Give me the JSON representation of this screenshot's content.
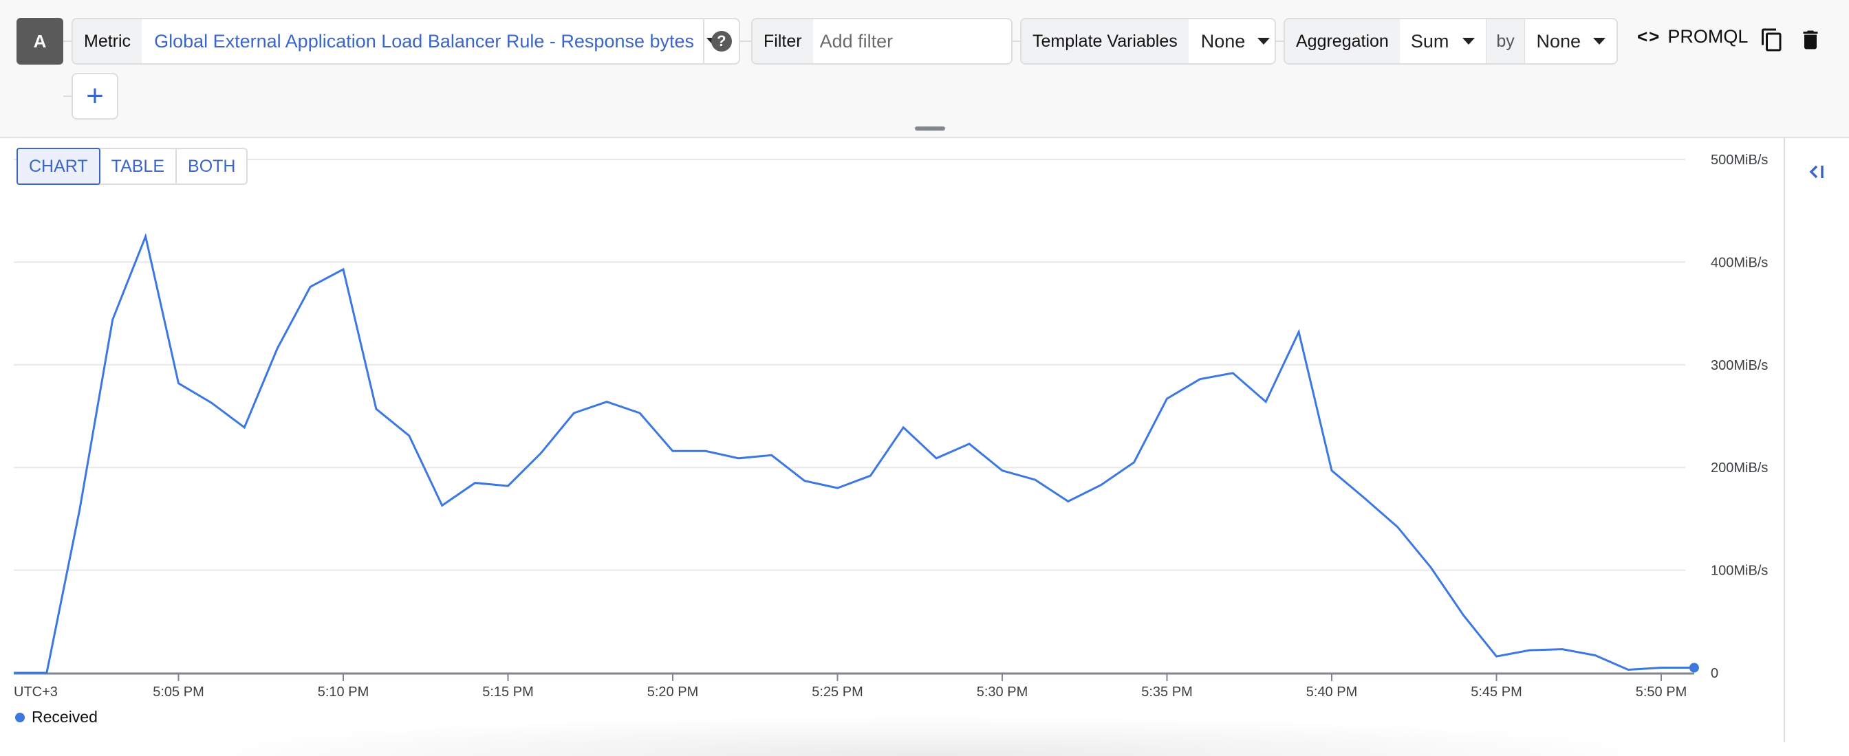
{
  "query": {
    "label": "A",
    "metric": {
      "label": "Metric",
      "value": "Global External Application Load Balancer Rule - Response bytes"
    },
    "help_icon": "help-circle-icon",
    "filter": {
      "label": "Filter",
      "placeholder": "Add filter",
      "value": ""
    },
    "template_variables": {
      "label": "Template Variables",
      "value": "None"
    },
    "aggregation": {
      "label": "Aggregation",
      "value": "Sum",
      "by_label": "by",
      "by_value": "None"
    },
    "promql_label": "PROMQL",
    "promql_icon": "<>",
    "add_button": "+"
  },
  "view_toggle": {
    "options": [
      "CHART",
      "TABLE",
      "BOTH"
    ],
    "selected": "CHART"
  },
  "side_panel": {
    "collapse_icon": "<|"
  },
  "colors": {
    "series": "#3c78e0",
    "accent": "#3b66c9"
  },
  "chart_data": {
    "type": "line",
    "title": "",
    "xlabel": "",
    "ylabel": "",
    "timezone_label": "UTC+3",
    "x": [
      "5:00 PM",
      "5:01 PM",
      "5:02 PM",
      "5:03 PM",
      "5:04 PM",
      "5:05 PM",
      "5:06 PM",
      "5:07 PM",
      "5:08 PM",
      "5:09 PM",
      "5:10 PM",
      "5:11 PM",
      "5:12 PM",
      "5:13 PM",
      "5:14 PM",
      "5:15 PM",
      "5:16 PM",
      "5:17 PM",
      "5:18 PM",
      "5:19 PM",
      "5:20 PM",
      "5:21 PM",
      "5:22 PM",
      "5:23 PM",
      "5:24 PM",
      "5:25 PM",
      "5:26 PM",
      "5:27 PM",
      "5:28 PM",
      "5:29 PM",
      "5:30 PM",
      "5:31 PM",
      "5:32 PM",
      "5:33 PM",
      "5:34 PM",
      "5:35 PM",
      "5:36 PM",
      "5:37 PM",
      "5:38 PM",
      "5:39 PM",
      "5:40 PM",
      "5:41 PM",
      "5:42 PM",
      "5:43 PM",
      "5:44 PM",
      "5:45 PM",
      "5:46 PM",
      "5:47 PM",
      "5:48 PM",
      "5:49 PM",
      "5:50 PM",
      "5:51 PM"
    ],
    "x_tick_labels": [
      "5:05 PM",
      "5:10 PM",
      "5:15 PM",
      "5:20 PM",
      "5:25 PM",
      "5:30 PM",
      "5:35 PM",
      "5:40 PM",
      "5:45 PM",
      "5:50 PM"
    ],
    "x_tick_minutes": [
      5,
      10,
      15,
      20,
      25,
      30,
      35,
      40,
      45,
      50
    ],
    "y_tick_labels": [
      "0",
      "100MiB/s",
      "200MiB/s",
      "300MiB/s",
      "400MiB/s",
      "500MiB/s"
    ],
    "y_ticks": [
      0,
      100,
      200,
      300,
      400,
      500
    ],
    "ylim": [
      0,
      500
    ],
    "y_unit": "MiB/s",
    "grid": true,
    "legend_position": "bottom-left",
    "series": [
      {
        "name": "Received",
        "color": "#3c78e0",
        "values": [
          0,
          0,
          159,
          344,
          425,
          282,
          263,
          239,
          316,
          376,
          393,
          257,
          231,
          163,
          185,
          182,
          214,
          253,
          264,
          253,
          216,
          216,
          209,
          212,
          187,
          180,
          192,
          239,
          209,
          223,
          197,
          188,
          167,
          183,
          205,
          267,
          286,
          292,
          264,
          332,
          197,
          170,
          142,
          103,
          56,
          16,
          22,
          23,
          17,
          3,
          5,
          5
        ]
      }
    ]
  }
}
